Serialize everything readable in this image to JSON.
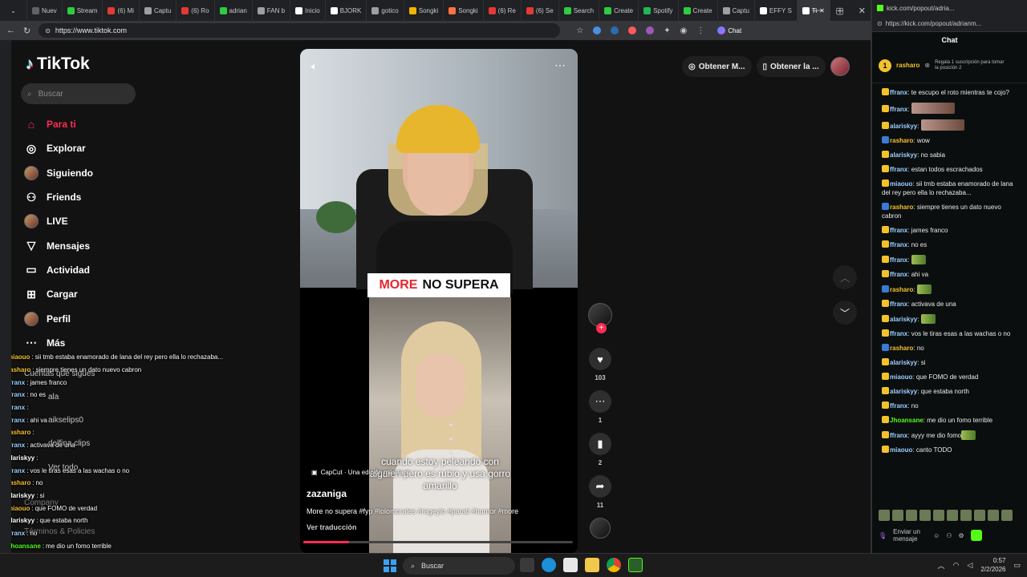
{
  "browser": {
    "tabs": [
      {
        "label": "Nuev",
        "color": "#5f6368"
      },
      {
        "label": "Stream",
        "color": "#2ecc40"
      },
      {
        "label": "(6) Mi",
        "color": "#e53935"
      },
      {
        "label": "Captu",
        "color": "#9aa0a6"
      },
      {
        "label": "(6) Ro",
        "color": "#e53935"
      },
      {
        "label": "adrian",
        "color": "#2ecc40"
      },
      {
        "label": "FAN b",
        "color": "#9aa0a6"
      },
      {
        "label": "Inicio",
        "color": "#ffffff"
      },
      {
        "label": "BJORK",
        "color": "#ffffff"
      },
      {
        "label": "gotico",
        "color": "#9aa0a6"
      },
      {
        "label": "Songki",
        "color": "#f4b400"
      },
      {
        "label": "Songki",
        "color": "#ff7043"
      },
      {
        "label": "(6) Re",
        "color": "#e53935"
      },
      {
        "label": "(6) Se",
        "color": "#e53935"
      },
      {
        "label": "Search",
        "color": "#2ecc40"
      },
      {
        "label": "Create",
        "color": "#2ecc40"
      },
      {
        "label": "Spotify",
        "color": "#1db954"
      },
      {
        "label": "Create",
        "color": "#2ecc40"
      },
      {
        "label": "Captu",
        "color": "#9aa0a6"
      },
      {
        "label": "EFFY S",
        "color": "#ffffff"
      },
      {
        "label": "Ti",
        "color": "#ffffff",
        "active": true
      }
    ],
    "new_tab": "+",
    "url": "https://www.tiktok.com",
    "chat_extension": "Chat"
  },
  "tiktok": {
    "logo": "TikTok",
    "search_placeholder": "Buscar",
    "nav": [
      {
        "label": "Para ti",
        "icon": "home-icon",
        "glyph": "⌂",
        "active": true
      },
      {
        "label": "Explorar",
        "icon": "compass-icon",
        "glyph": "◎"
      },
      {
        "label": "Siguiendo",
        "icon": "avatar-icon",
        "glyph": ""
      },
      {
        "label": "Friends",
        "icon": "friends-icon",
        "glyph": "⚇"
      },
      {
        "label": "LIVE",
        "icon": "avatar-icon",
        "glyph": ""
      },
      {
        "label": "Mensajes",
        "icon": "send-icon",
        "glyph": "▽"
      },
      {
        "label": "Actividad",
        "icon": "activity-icon",
        "glyph": "▭"
      },
      {
        "label": "Cargar",
        "icon": "upload-icon",
        "glyph": "⊞"
      },
      {
        "label": "Perfil",
        "icon": "avatar-icon",
        "glyph": ""
      },
      {
        "label": "Más",
        "icon": "more-icon",
        "glyph": "⋯"
      }
    ],
    "sidebar_extra": {
      "following_title": "Cuentas que sigues",
      "account_1": "ala",
      "account_2": "aikselips0",
      "account_3": "delfina clips",
      "see_all": "Ver todo",
      "company": "Company",
      "terms": "Términos & Policies"
    },
    "top_actions": {
      "get_coins": "Obtener M...",
      "get_app": "Obtener la ..."
    },
    "video": {
      "caption_red": "MORE",
      "caption_black": "NO SUPERA",
      "clip_text": "cuando estoy peleando con alguien pero es rubio y usa gorro amarillo",
      "capcut": "CapCut · Una edición más fácil",
      "author": "zazaniga",
      "description": "More no supera #fyp #lolomorales #rageylo #parati #humor #more",
      "translate": "Ver traducción",
      "progress": 0.17
    },
    "actions": {
      "likes": "103",
      "comments": "1",
      "saves": "2",
      "shares": "11"
    }
  },
  "overlay_chat": [
    {
      "user": "miaouo",
      "color": "#f3c12b",
      "text": "sii tmb estaba enamorado de lana del rey pero ella lo rechazaba..."
    },
    {
      "user": "rasharo",
      "color": "#f3c12b",
      "text": "siempre tienes un dato nuevo cabron"
    },
    {
      "user": "ffranx",
      "color": "#9ad0ff",
      "text": "james franco"
    },
    {
      "user": "ffranx",
      "color": "#9ad0ff",
      "text": "no es"
    },
    {
      "user": "ffranx",
      "color": "#9ad0ff",
      "text": ""
    },
    {
      "user": "ffranx",
      "color": "#9ad0ff",
      "text": "ahi va"
    },
    {
      "user": "rasharo",
      "color": "#f3c12b",
      "text": ""
    },
    {
      "user": "ffranx",
      "color": "#9ad0ff",
      "text": "activava de una"
    },
    {
      "user": "alariskyy",
      "color": "#ffffff",
      "text": ""
    },
    {
      "user": "ffranx",
      "color": "#9ad0ff",
      "text": "vos le tiras esas a las wachas o no"
    },
    {
      "user": "rasharo",
      "color": "#f3c12b",
      "text": "no"
    },
    {
      "user": "alariskyy",
      "color": "#ffffff",
      "text": "si"
    },
    {
      "user": "miaouo",
      "color": "#f3c12b",
      "text": "que FOMO de verdad"
    },
    {
      "user": "alariskyy",
      "color": "#ffffff",
      "text": "que estaba north"
    },
    {
      "user": "ffranx",
      "color": "#9ad0ff",
      "text": "no"
    },
    {
      "user": "Jhoansane",
      "color": "#53fc18",
      "text": "me dio un fomo terrible"
    },
    {
      "user": "ffranx",
      "color": "#9ad0ff",
      "text": "ayyy me dio fomo"
    },
    {
      "user": "miaouo",
      "color": "#f3c12b",
      "text": "canto TODO"
    }
  ],
  "kick": {
    "window_title": "kick.com/popout/adria...",
    "url": "https://kick.com/popout/adrianm...",
    "header": "Chat",
    "pinned_user": "rasharo",
    "pinned_count": "1",
    "pinned_note": "Regala 1 suscripción para tomar la posición 2",
    "messages": [
      {
        "user": "ffranx",
        "color": "#9ad0ff",
        "text": "te escupo el roto mientras te cojo?"
      },
      {
        "user": "ffranx",
        "color": "#9ad0ff",
        "text": "",
        "emote": "img"
      },
      {
        "user": "alariskyy",
        "color": "#9ad0ff",
        "text": "",
        "emote": "img"
      },
      {
        "user": "rasharo",
        "color": "#f3c12b",
        "text": "wow"
      },
      {
        "user": "alariskyy",
        "color": "#9ad0ff",
        "text": "no sabia"
      },
      {
        "user": "ffranx",
        "color": "#9ad0ff",
        "text": "estan todos escrachados"
      },
      {
        "user": "miaouo",
        "color": "#9ad0ff",
        "text": "sii tmb estaba enamorado de lana del rey pero ella lo rechazaba..."
      },
      {
        "user": "rasharo",
        "color": "#f3c12b",
        "text": "siempre tienes un dato nuevo cabron"
      },
      {
        "user": "ffranx",
        "color": "#9ad0ff",
        "text": "james franco"
      },
      {
        "user": "ffranx",
        "color": "#9ad0ff",
        "text": "no es"
      },
      {
        "user": "ffranx",
        "color": "#9ad0ff",
        "text": "",
        "emote": "sm"
      },
      {
        "user": "ffranx",
        "color": "#9ad0ff",
        "text": "ahi va"
      },
      {
        "user": "rasharo",
        "color": "#f3c12b",
        "text": "",
        "emote": "sm"
      },
      {
        "user": "ffranx",
        "color": "#9ad0ff",
        "text": "activava de una"
      },
      {
        "user": "alariskyy",
        "color": "#9ad0ff",
        "text": "",
        "emote": "sm"
      },
      {
        "user": "ffranx",
        "color": "#9ad0ff",
        "text": "vos le tiras esas a las wachas o no"
      },
      {
        "user": "rasharo",
        "color": "#f3c12b",
        "text": "no"
      },
      {
        "user": "alariskyy",
        "color": "#9ad0ff",
        "text": "si"
      },
      {
        "user": "miaouo",
        "color": "#9ad0ff",
        "text": "que FOMO de verdad"
      },
      {
        "user": "alariskyy",
        "color": "#9ad0ff",
        "text": "que estaba north"
      },
      {
        "user": "ffranx",
        "color": "#9ad0ff",
        "text": "no"
      },
      {
        "user": "Jhoansane",
        "color": "#53fc18",
        "text": "me dio un fomo terrible"
      },
      {
        "user": "ffranx",
        "color": "#9ad0ff",
        "text": "ayyy me dio fomo",
        "emote": "sm"
      },
      {
        "user": "miaouo",
        "color": "#9ad0ff",
        "text": "canto TODO"
      }
    ],
    "input_placeholder": "Enviar un mensaje"
  },
  "taskbar": {
    "search": "Buscar",
    "time": "0:57",
    "date": "2/2/2026"
  }
}
